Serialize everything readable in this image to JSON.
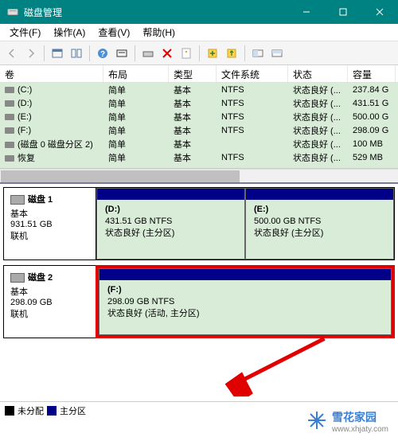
{
  "window": {
    "title": "磁盘管理"
  },
  "menu": {
    "file": "文件(F)",
    "action": "操作(A)",
    "view": "查看(V)",
    "help": "帮助(H)"
  },
  "table": {
    "headers": {
      "volume": "卷",
      "layout": "布局",
      "type": "类型",
      "filesystem": "文件系统",
      "status": "状态",
      "capacity": "容量"
    },
    "rows": [
      {
        "vol": "(C:)",
        "layout": "简单",
        "type": "基本",
        "fs": "NTFS",
        "status": "状态良好 (...",
        "cap": "237.84 G"
      },
      {
        "vol": "(D:)",
        "layout": "简单",
        "type": "基本",
        "fs": "NTFS",
        "status": "状态良好 (...",
        "cap": "431.51 G"
      },
      {
        "vol": "(E:)",
        "layout": "简单",
        "type": "基本",
        "fs": "NTFS",
        "status": "状态良好 (...",
        "cap": "500.00 G"
      },
      {
        "vol": "(F:)",
        "layout": "简单",
        "type": "基本",
        "fs": "NTFS",
        "status": "状态良好 (...",
        "cap": "298.09 G"
      },
      {
        "vol": "(磁盘 0 磁盘分区 2)",
        "layout": "简单",
        "type": "基本",
        "fs": "",
        "status": "状态良好 (...",
        "cap": "100 MB"
      },
      {
        "vol": "恢复",
        "layout": "简单",
        "type": "基本",
        "fs": "NTFS",
        "status": "状态良好 (...",
        "cap": "529 MB"
      }
    ]
  },
  "disks": [
    {
      "name": "磁盘 1",
      "type": "基本",
      "size": "931.51 GB",
      "state": "联机",
      "highlight": false,
      "parts": [
        {
          "letter": "(D:)",
          "size": "431.51 GB NTFS",
          "status": "状态良好 (主分区)"
        },
        {
          "letter": "(E:)",
          "size": "500.00 GB NTFS",
          "status": "状态良好 (主分区)"
        }
      ]
    },
    {
      "name": "磁盘 2",
      "type": "基本",
      "size": "298.09 GB",
      "state": "联机",
      "highlight": true,
      "parts": [
        {
          "letter": "(F:)",
          "size": "298.09 GB NTFS",
          "status": "状态良好 (活动, 主分区)"
        }
      ]
    }
  ],
  "legend": {
    "unallocated": "未分配",
    "primary": "主分区"
  },
  "watermark": {
    "brand": "雪花家园",
    "site": "www.xhjaty.com"
  }
}
